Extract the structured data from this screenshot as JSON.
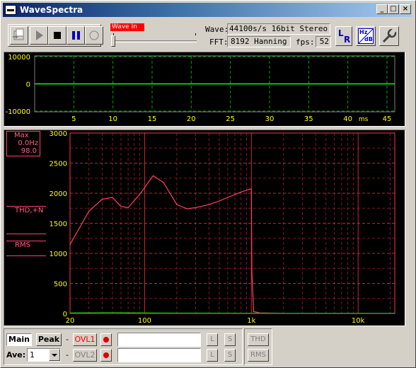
{
  "window": {
    "title": "WaveSpectra"
  },
  "title_buttons": {
    "minimize": "_",
    "maximize": "□",
    "close": "×"
  },
  "toolbar": {
    "wave_in_label": "Wave In",
    "wave_label": "Wave:",
    "wave_value": "44100s/s 16bit Stereo",
    "fft_label": "FFT:",
    "fft_value": "8192 Hanning",
    "fps_label": "fps:",
    "fps_value": "52",
    "lr_left": "L",
    "lr_right": "R",
    "hz_label": "Hz",
    "db_label": "dB"
  },
  "wave_plot": {
    "y_ticks": [
      "10000",
      "0",
      "-10000"
    ],
    "x_ticks": [
      "5",
      "10",
      "15",
      "20",
      "25",
      "30",
      "35",
      "40",
      "45"
    ],
    "x_unit": "ms"
  },
  "spectrum_plot": {
    "y_ticks": [
      "3000",
      "2500",
      "2000",
      "1500",
      "1000",
      "500",
      "0"
    ],
    "x_ticks": [
      "20",
      "100",
      "1k",
      "10k"
    ],
    "max_label": "Max",
    "max_hz": "0.0Hz",
    "max_value": "98.0",
    "thd_label": "THD,+N",
    "rms_label": "RMS"
  },
  "chart_data": {
    "type": "line",
    "xlabel": "",
    "ylabel": "",
    "x_scale": "log",
    "xlim": [
      20,
      22050
    ],
    "ylim": [
      0,
      3000
    ],
    "series": [
      {
        "color": "#ff4060",
        "x": [
          20,
          25,
          30,
          40,
          50,
          60,
          70,
          90,
          120,
          150,
          200,
          250,
          300,
          400,
          500,
          600,
          800,
          980,
          1000,
          1010,
          1050,
          1200,
          2000,
          5000,
          10000,
          22050
        ],
        "values": [
          1150,
          1450,
          1700,
          1900,
          1930,
          1780,
          1760,
          1980,
          2290,
          2180,
          1810,
          1740,
          1760,
          1810,
          1870,
          1930,
          2020,
          2070,
          2070,
          700,
          30,
          10,
          5,
          5,
          5,
          5
        ]
      },
      {
        "color": "#00c000",
        "x": [
          20,
          50,
          100,
          200,
          500,
          1000,
          2000,
          5000,
          10000,
          22050
        ],
        "values": [
          10,
          15,
          10,
          8,
          6,
          5,
          4,
          3,
          3,
          3
        ]
      }
    ]
  },
  "bottom": {
    "tab_main": "Main",
    "tab_peak": "Peak",
    "dash1": "-",
    "dash2": "-",
    "ovl1": "OVL1",
    "ovl2": "OVL2",
    "ave_label": "Ave:",
    "ave_value": "1",
    "l_btn": "L",
    "s_btn": "S",
    "thd_btn": "THD",
    "rms_btn": "RMS"
  },
  "colors": {
    "grid_wave": "#00a000",
    "grid_spec": "#ff3050",
    "tick_text": "#ffff00",
    "spectrum_line": "#ff4060"
  }
}
